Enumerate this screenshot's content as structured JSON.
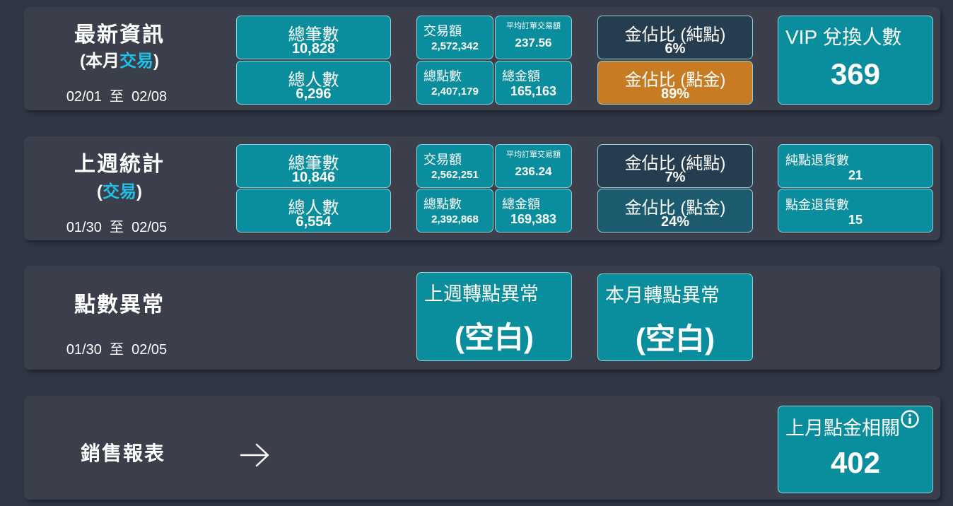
{
  "latest": {
    "title": "最新資訊",
    "sub_prefix": "(本月",
    "sub_highlight": "交易",
    "sub_suffix": ")",
    "date_start": "02/01",
    "date_sep": "至",
    "date_end": "02/08",
    "total_count_label": "總筆數",
    "total_count": "10,828",
    "total_people_label": "總人數",
    "total_people": "6,296",
    "amount_label": "交易額",
    "amount": "2,572,342",
    "avg_label": "平均訂單交易額",
    "avg": "237.56",
    "points_label": "總點數",
    "points": "2,407,179",
    "gold_label": "總金額",
    "gold": "165,163",
    "ratio_pure_label": "金佔比 (純點)",
    "ratio_pure": "6%",
    "ratio_mix_label": "金佔比 (點金)",
    "ratio_mix": "89%",
    "vip_label": "VIP 兌換人數",
    "vip": "369"
  },
  "lastweek": {
    "title": "上週統計",
    "sub_prefix": "(",
    "sub_highlight": "交易",
    "sub_suffix": ")",
    "date_start": "01/30",
    "date_sep": "至",
    "date_end": "02/05",
    "total_count_label": "總筆數",
    "total_count": "10,846",
    "total_people_label": "總人數",
    "total_people": "6,554",
    "amount_label": "交易額",
    "amount": "2,562,251",
    "avg_label": "平均訂單交易額",
    "avg": "236.24",
    "points_label": "總點數",
    "points": "2,392,868",
    "gold_label": "總金額",
    "gold": "169,383",
    "ratio_pure_label": "金佔比 (純點)",
    "ratio_pure": "7%",
    "ratio_mix_label": "金佔比 (點金)",
    "ratio_mix": "24%",
    "return_pure_label": "純點退貨數",
    "return_pure": "21",
    "return_mix_label": "點金退貨數",
    "return_mix": "15"
  },
  "anomaly": {
    "title": "點數異常",
    "date_start": "01/30",
    "date_sep": "至",
    "date_end": "02/05",
    "week_label": "上週轉點異常",
    "week_value": "(空白)",
    "month_label": "本月轉點異常",
    "month_value": "(空白)"
  },
  "sales": {
    "title": "銷售報表",
    "arrow_icon": "arrow-right-icon",
    "related_label": "上月點金相關",
    "related_value": "402",
    "info_icon": "info-icon"
  },
  "colors": {
    "background": "#2f3645",
    "panel": "#3a3f4b",
    "teal": "#0a8e9e",
    "dark_navy": "#263d4f",
    "dark_teal": "#1c5b6d",
    "orange": "#c77b22",
    "highlight": "#1fbfe6"
  }
}
